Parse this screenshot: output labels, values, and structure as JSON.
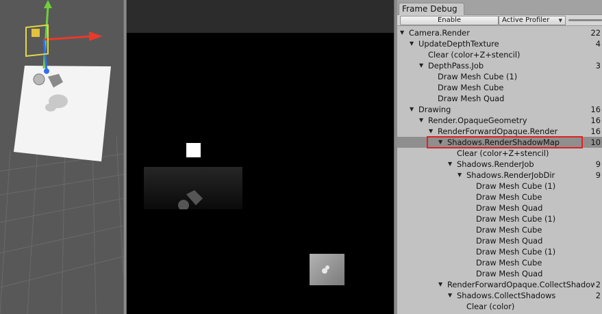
{
  "frame_debug": {
    "tab_title": "Frame Debug",
    "enable_label": "Enable",
    "profiler_label": "Active Profiler",
    "tree": [
      {
        "indent": 0,
        "expanded": true,
        "label": "Camera.Render",
        "count": "22"
      },
      {
        "indent": 1,
        "expanded": true,
        "label": "UpdateDepthTexture",
        "count": "4"
      },
      {
        "indent": 2,
        "expanded": null,
        "label": "Clear (color+Z+stencil)",
        "count": ""
      },
      {
        "indent": 2,
        "expanded": true,
        "label": "DepthPass.Job",
        "count": "3"
      },
      {
        "indent": 3,
        "expanded": null,
        "label": "Draw Mesh Cube (1)",
        "count": ""
      },
      {
        "indent": 3,
        "expanded": null,
        "label": "Draw Mesh Cube",
        "count": ""
      },
      {
        "indent": 3,
        "expanded": null,
        "label": "Draw Mesh Quad",
        "count": ""
      },
      {
        "indent": 1,
        "expanded": true,
        "label": "Drawing",
        "count": "16"
      },
      {
        "indent": 2,
        "expanded": true,
        "label": "Render.OpaqueGeometry",
        "count": "16"
      },
      {
        "indent": 3,
        "expanded": true,
        "label": "RenderForwardOpaque.Render",
        "count": "16"
      },
      {
        "indent": 4,
        "expanded": true,
        "label": "Shadows.RenderShadowMap",
        "count": "10",
        "selected": true
      },
      {
        "indent": 5,
        "expanded": null,
        "label": "Clear (color+Z+stencil)",
        "count": ""
      },
      {
        "indent": 5,
        "expanded": true,
        "label": "Shadows.RenderJob",
        "count": "9"
      },
      {
        "indent": 6,
        "expanded": true,
        "label": "Shadows.RenderJobDir",
        "count": "9"
      },
      {
        "indent": 7,
        "expanded": null,
        "label": "Draw Mesh Cube (1)",
        "count": ""
      },
      {
        "indent": 7,
        "expanded": null,
        "label": "Draw Mesh Cube",
        "count": ""
      },
      {
        "indent": 7,
        "expanded": null,
        "label": "Draw Mesh Quad",
        "count": ""
      },
      {
        "indent": 7,
        "expanded": null,
        "label": "Draw Mesh Cube (1)",
        "count": ""
      },
      {
        "indent": 7,
        "expanded": null,
        "label": "Draw Mesh Cube",
        "count": ""
      },
      {
        "indent": 7,
        "expanded": null,
        "label": "Draw Mesh Quad",
        "count": ""
      },
      {
        "indent": 7,
        "expanded": null,
        "label": "Draw Mesh Cube (1)",
        "count": ""
      },
      {
        "indent": 7,
        "expanded": null,
        "label": "Draw Mesh Cube",
        "count": ""
      },
      {
        "indent": 7,
        "expanded": null,
        "label": "Draw Mesh Quad",
        "count": ""
      },
      {
        "indent": 4,
        "expanded": true,
        "label": "RenderForwardOpaque.CollectShadows",
        "count": "2"
      },
      {
        "indent": 5,
        "expanded": true,
        "label": "Shadows.CollectShadows",
        "count": "2"
      },
      {
        "indent": 6,
        "expanded": null,
        "label": "Clear (color)",
        "count": ""
      }
    ]
  },
  "colors": {
    "highlight_border": "#e12020",
    "selected_row": "#8f8f8f",
    "gizmo_x": "#e8392a",
    "gizmo_y": "#6fcf3a",
    "gizmo_z": "#2f6ff0"
  }
}
